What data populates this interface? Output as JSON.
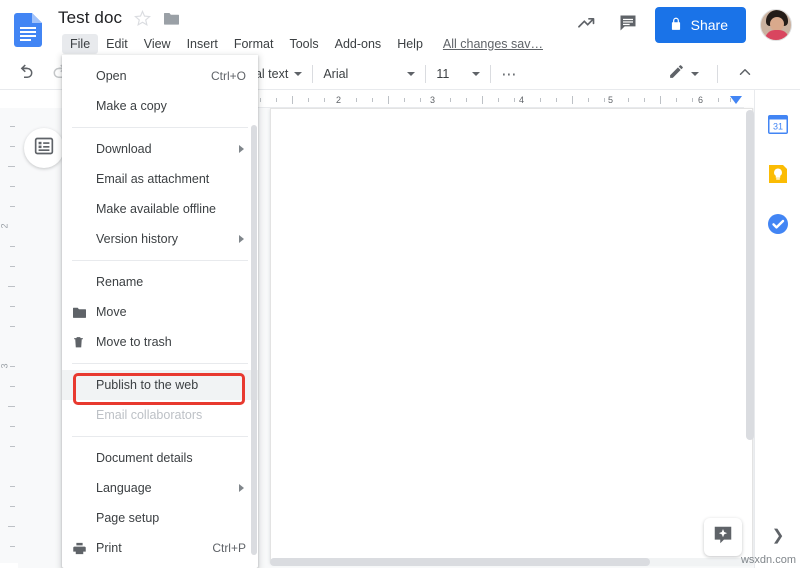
{
  "app": {
    "name": "Google Docs",
    "accent_color": "#1a73e8",
    "highlight_color": "#e8392f"
  },
  "header": {
    "doc_title": "Test doc",
    "star_icon": "star-outline-icon",
    "folder_icon": "folder-icon",
    "menus": [
      {
        "label": "File",
        "active": true
      },
      {
        "label": "Edit",
        "active": false
      },
      {
        "label": "View",
        "active": false
      },
      {
        "label": "Insert",
        "active": false
      },
      {
        "label": "Format",
        "active": false
      },
      {
        "label": "Tools",
        "active": false
      },
      {
        "label": "Add-ons",
        "active": false
      },
      {
        "label": "Help",
        "active": false
      }
    ],
    "save_status": "All changes sav…",
    "activity_icon": "trending-up-icon",
    "comment_icon": "comment-icon",
    "share_label": "Share",
    "share_lock_icon": "lock-icon",
    "avatar": "user-avatar"
  },
  "toolbar": {
    "undo_icon": "undo-icon",
    "redo_icon": "redo-icon",
    "style_value": "nal text",
    "font_value": "Arial",
    "size_value": "11",
    "more_icon": "more-horizontal-icon",
    "edit_mode_icon": "pencil-icon",
    "collapse_icon": "chevron-up-icon"
  },
  "ruler": {
    "horizontal_numbers": [
      "2",
      "3",
      "4",
      "5",
      "6"
    ],
    "vertical_numbers": [
      "2",
      "3"
    ]
  },
  "left_pane": {
    "outline_icon": "document-outline-icon"
  },
  "file_menu": {
    "groups": [
      {
        "items": [
          {
            "label": "Open",
            "accel": "Ctrl+O",
            "icon": null,
            "submenu": false,
            "disabled": false,
            "highlighted": false
          },
          {
            "label": "Make a copy",
            "accel": "",
            "icon": null,
            "submenu": false,
            "disabled": false,
            "highlighted": false
          }
        ]
      },
      {
        "items": [
          {
            "label": "Download",
            "accel": "",
            "icon": null,
            "submenu": true,
            "disabled": false,
            "highlighted": false
          },
          {
            "label": "Email as attachment",
            "accel": "",
            "icon": null,
            "submenu": false,
            "disabled": false,
            "highlighted": false
          },
          {
            "label": "Make available offline",
            "accel": "",
            "icon": null,
            "submenu": false,
            "disabled": false,
            "highlighted": false
          },
          {
            "label": "Version history",
            "accel": "",
            "icon": null,
            "submenu": true,
            "disabled": false,
            "highlighted": false
          }
        ]
      },
      {
        "items": [
          {
            "label": "Rename",
            "accel": "",
            "icon": null,
            "submenu": false,
            "disabled": false,
            "highlighted": false
          },
          {
            "label": "Move",
            "accel": "",
            "icon": "folder-icon",
            "submenu": false,
            "disabled": false,
            "highlighted": false
          },
          {
            "label": "Move to trash",
            "accel": "",
            "icon": "trash-icon",
            "submenu": false,
            "disabled": false,
            "highlighted": false
          }
        ]
      },
      {
        "items": [
          {
            "label": "Publish to the web",
            "accel": "",
            "icon": null,
            "submenu": false,
            "disabled": false,
            "highlighted": true
          },
          {
            "label": "Email collaborators",
            "accel": "",
            "icon": null,
            "submenu": false,
            "disabled": true,
            "highlighted": false
          }
        ]
      },
      {
        "items": [
          {
            "label": "Document details",
            "accel": "",
            "icon": null,
            "submenu": false,
            "disabled": false,
            "highlighted": false
          },
          {
            "label": "Language",
            "accel": "",
            "icon": null,
            "submenu": true,
            "disabled": false,
            "highlighted": false
          },
          {
            "label": "Page setup",
            "accel": "",
            "icon": null,
            "submenu": false,
            "disabled": false,
            "highlighted": false
          },
          {
            "label": "Print",
            "accel": "Ctrl+P",
            "icon": "printer-icon",
            "submenu": false,
            "disabled": false,
            "highlighted": false
          }
        ]
      }
    ]
  },
  "side_panel": {
    "items": [
      {
        "name": "google-calendar-icon",
        "label": "31"
      },
      {
        "name": "google-keep-icon",
        "label": ""
      },
      {
        "name": "google-tasks-icon",
        "label": ""
      }
    ],
    "expand_icon": "chevron-right-icon"
  },
  "document": {
    "explore_icon": "explore-icon",
    "watermark": "wsxdn.com"
  }
}
